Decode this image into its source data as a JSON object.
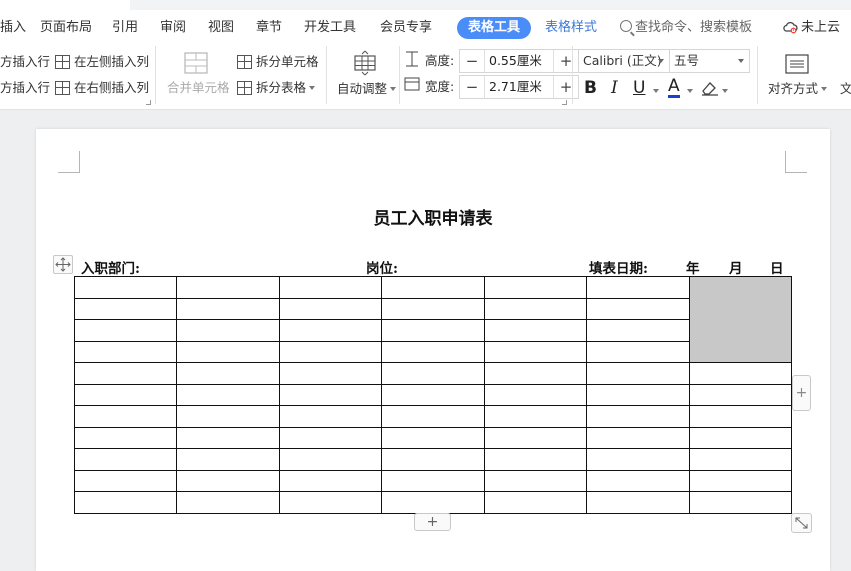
{
  "ribbon": {
    "tabs": [
      {
        "label": "插入"
      },
      {
        "label": "页面布局"
      },
      {
        "label": "引用"
      },
      {
        "label": "审阅"
      },
      {
        "label": "视图"
      },
      {
        "label": "章节"
      },
      {
        "label": "开发工具"
      },
      {
        "label": "会员专享"
      },
      {
        "label": "表格工具",
        "active": true
      },
      {
        "label": "表格样式"
      }
    ],
    "search_label": "查找命令、搜索模板",
    "cloud_label": "未上云",
    "accent_color": "#4a8df8"
  },
  "toolbar": {
    "insert_row_above": "方插入行",
    "insert_row_below": "方插入行",
    "insert_col_left": "在左侧插入列",
    "insert_col_right": "在右侧插入列",
    "merge_cells": "合并单元格",
    "split_cells": "拆分单元格",
    "split_table": "拆分表格",
    "auto_fit": "自动调整",
    "height_label": "高度:",
    "height_value": "0.55厘米",
    "width_label": "宽度:",
    "width_value": "2.71厘米",
    "font_name": "Calibri (正文)",
    "font_size": "五号",
    "align_label": "对齐方式",
    "text_dir_label": "文",
    "bold": "B",
    "italic": "I",
    "underline": "U",
    "font_color_letter": "A",
    "minus": "−",
    "plus": "+"
  },
  "document": {
    "title": "员工入职申请表",
    "header": {
      "department": "入职部门:",
      "position": "岗位:",
      "fill_date": "填表日期:",
      "year": "年",
      "month": "月",
      "day": "日"
    },
    "table": {
      "rows": 11,
      "cols": 7,
      "shaded_cell_color": "#c8c8c8"
    },
    "add_symbol": "+"
  }
}
